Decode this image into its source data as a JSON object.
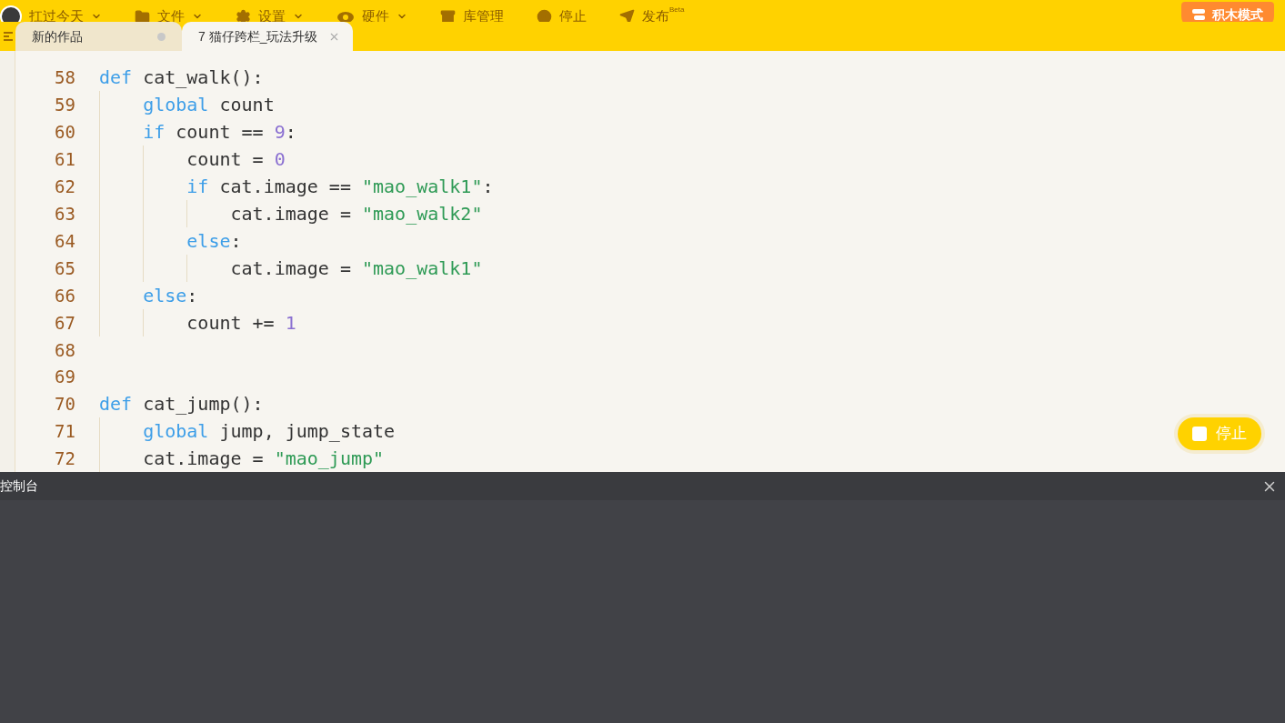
{
  "menu": [
    {
      "label": "扛过今天",
      "kind": "user",
      "dropdown": true
    },
    {
      "label": "文件",
      "kind": "folder",
      "dropdown": true
    },
    {
      "label": "设置",
      "kind": "gear",
      "dropdown": true
    },
    {
      "label": "硬件",
      "kind": "hardware",
      "dropdown": true
    },
    {
      "label": "库管理",
      "kind": "library",
      "dropdown": false
    },
    {
      "label": "停止",
      "kind": "stop",
      "dropdown": false
    },
    {
      "label": "发布",
      "kind": "send",
      "dropdown": false,
      "badge": "Beta"
    }
  ],
  "mode_button": "积木模式",
  "tabs": [
    {
      "label": "新的作品",
      "selected": false,
      "modified": true
    },
    {
      "label": "7 猫仔跨栏_玩法升级",
      "selected": true,
      "modified": false
    }
  ],
  "code": [
    {
      "number": "58",
      "tokens": [
        {
          "kind": "keyword",
          "text": "def"
        },
        {
          "kind": "plain",
          "text": " cat_walk():"
        }
      ]
    },
    {
      "number": "59",
      "tokens": [
        {
          "kind": "keyword",
          "text": "    global"
        },
        {
          "kind": "plain",
          "text": " count"
        }
      ]
    },
    {
      "number": "60",
      "tokens": [
        {
          "kind": "keyword",
          "text": "    if"
        },
        {
          "kind": "plain",
          "text": " count == "
        },
        {
          "kind": "number",
          "text": "9"
        },
        {
          "kind": "plain",
          "text": ":"
        }
      ]
    },
    {
      "number": "61",
      "tokens": [
        {
          "kind": "plain",
          "text": "        count = "
        },
        {
          "kind": "number",
          "text": "0"
        }
      ]
    },
    {
      "number": "62",
      "tokens": [
        {
          "kind": "keyword",
          "text": "        if"
        },
        {
          "kind": "plain",
          "text": " cat.image == "
        },
        {
          "kind": "string",
          "text": "\"mao_walk1\""
        },
        {
          "kind": "plain",
          "text": ":"
        }
      ]
    },
    {
      "number": "63",
      "tokens": [
        {
          "kind": "plain",
          "text": "            cat.image = "
        },
        {
          "kind": "string",
          "text": "\"mao_walk2\""
        }
      ]
    },
    {
      "number": "64",
      "tokens": [
        {
          "kind": "keyword",
          "text": "        else"
        },
        {
          "kind": "plain",
          "text": ":"
        }
      ]
    },
    {
      "number": "65",
      "tokens": [
        {
          "kind": "plain",
          "text": "            cat.image = "
        },
        {
          "kind": "string",
          "text": "\"mao_walk1\""
        }
      ]
    },
    {
      "number": "66",
      "tokens": [
        {
          "kind": "keyword",
          "text": "    else"
        },
        {
          "kind": "plain",
          "text": ":"
        }
      ]
    },
    {
      "number": "67",
      "tokens": [
        {
          "kind": "plain",
          "text": "        count += "
        },
        {
          "kind": "number",
          "text": "1"
        }
      ]
    },
    {
      "number": "68"
    },
    {
      "number": "69"
    },
    {
      "number": "70",
      "tokens": [
        {
          "kind": "keyword",
          "text": "def"
        },
        {
          "kind": "plain",
          "text": " cat_jump():"
        }
      ]
    },
    {
      "number": "71",
      "tokens": [
        {
          "kind": "keyword",
          "text": "    global"
        },
        {
          "kind": "plain",
          "text": " jump, jump_state"
        }
      ]
    },
    {
      "number": "72",
      "tokens": [
        {
          "kind": "plain",
          "text": "    cat.image = "
        },
        {
          "kind": "string",
          "text": "\"mao_jump\""
        }
      ]
    }
  ],
  "stop_button": "停止",
  "console": {
    "title": "控制台"
  }
}
